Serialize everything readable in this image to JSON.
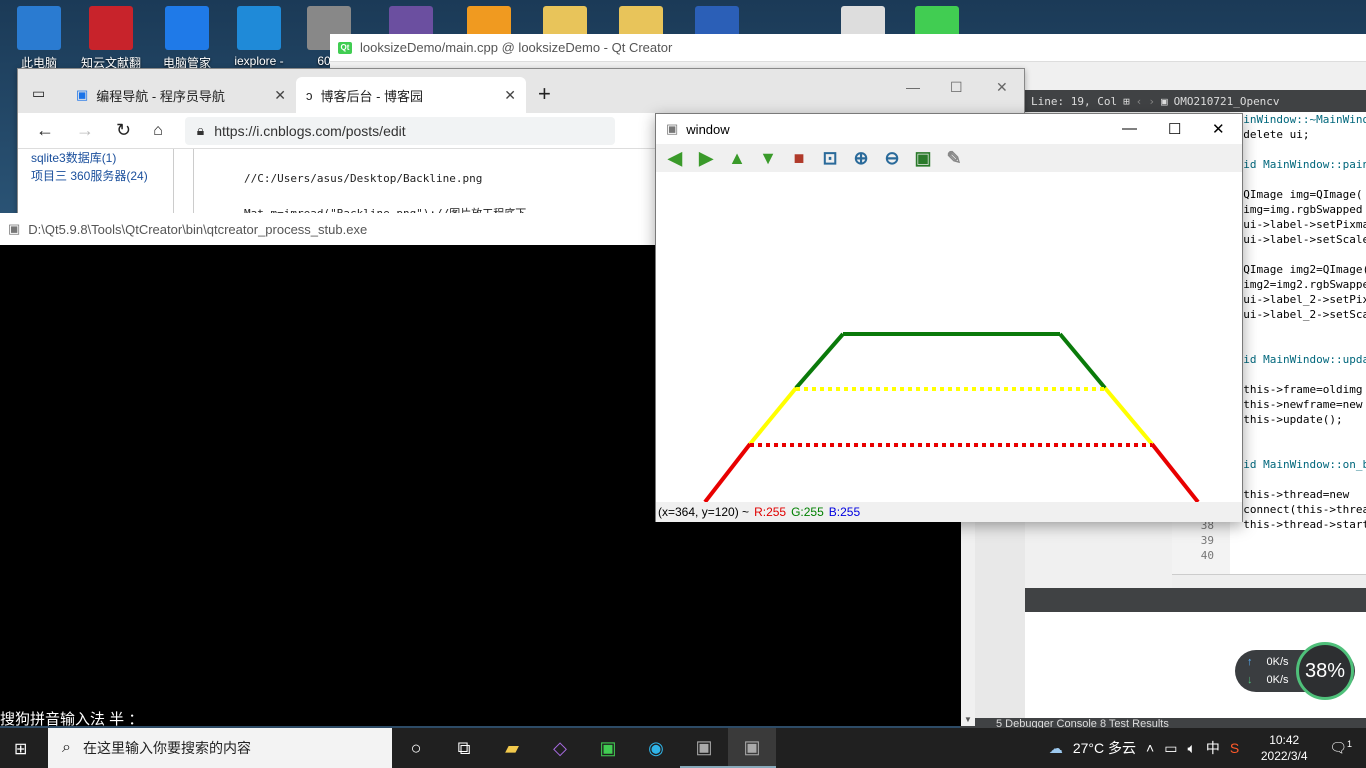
{
  "desktop": {
    "icons": [
      {
        "label": "此电脑",
        "color": "#2a7bd1"
      },
      {
        "label": "知云文献翻",
        "color": "#c8232b"
      },
      {
        "label": "电脑管家",
        "color": "#1f7ae8"
      },
      {
        "label": "iexplore -",
        "color": "#1f8ad8"
      },
      {
        "label": "60.0",
        "color": "#888"
      },
      {
        "label": "",
        "color": "#6b4fa0"
      },
      {
        "label": "",
        "color": "#f09a20"
      },
      {
        "label": "",
        "color": "#e8c45a"
      },
      {
        "label": "",
        "color": "#e8c45a"
      },
      {
        "label": "",
        "color": "#2b5fb7"
      },
      {
        "label": "",
        "color": "#ddd"
      },
      {
        "label": "",
        "color": "#41cd52"
      }
    ]
  },
  "qtcreator": {
    "title": "looksizeDemo/main.cpp @ looksizeDemo - Qt Creator",
    "logo": "Qt",
    "editorbar": {
      "line_col": "Line: 19, Col",
      "file": "OMO210721_Opencv"
    },
    "code_lines": [
      "MainWindow::~MainWindow()",
      "  delete ui;",
      "",
      "void MainWindow::paintEvent",
      "",
      "  QImage img=QImage(",
      "  img=img.rgbSwapped",
      "  ui->label->setPixmap",
      "  ui->label->setScaledContents",
      "",
      "  QImage img2=QImage(",
      "  img2=img2.rgbSwapped",
      "  ui->label_2->setPixmap",
      "  ui->label_2->setScaled",
      "",
      "",
      "void MainWindow::update",
      "",
      "  this->frame=oldimg",
      "  this->newframe=new",
      "  this->update();",
      "",
      "",
      "void MainWindow::on_btn",
      "{",
      "  this->thread=new",
      "  connect(this->thread",
      "  this->thread->start"
    ],
    "gutter": [
      "38",
      "39",
      "40"
    ],
    "bottom_tabs": "5 Debugger Console   8 Test Results"
  },
  "edge": {
    "tabs": [
      {
        "label": "编程导航 - 程序员导航"
      },
      {
        "label": "博客后台 - 博客园"
      }
    ],
    "url": "https://i.cnblogs.com/posts/edit",
    "sidebar": [
      "sqlite3数据库(1)",
      "项目三 360服务器(24)"
    ],
    "code": [
      "//C:/Users/asus/Desktop/Backline.png",
      "Mat m=imread(\"Backline.png\");//图片放工程底下"
    ]
  },
  "console": {
    "title": "D:\\Qt5.9.8\\Tools\\QtCreator\\bin\\qtcreator_process_stub.exe",
    "ime": "搜狗拼音输入法 半 ："
  },
  "cvwin": {
    "title": "window",
    "status": {
      "coords": "(x=364, y=120) ~",
      "r": "R:255",
      "g": "G:255",
      "b": "B:255"
    },
    "tools": [
      {
        "icon": "arrow-left",
        "color": "#3a9a2a",
        "glyph": "◀"
      },
      {
        "icon": "arrow-right",
        "color": "#3a9a2a",
        "glyph": "▶"
      },
      {
        "icon": "arrow-up",
        "color": "#3a9a2a",
        "glyph": "▲"
      },
      {
        "icon": "arrow-down",
        "color": "#3a9a2a",
        "glyph": "▼"
      },
      {
        "icon": "image",
        "color": "#b03a2a",
        "glyph": "■"
      },
      {
        "icon": "zoom-region",
        "color": "#2a6a9a",
        "glyph": "⊡"
      },
      {
        "icon": "zoom-in",
        "color": "#2a6a9a",
        "glyph": "⊕"
      },
      {
        "icon": "zoom-out",
        "color": "#2a6a9a",
        "glyph": "⊖"
      },
      {
        "icon": "save",
        "color": "#2a7a2a",
        "glyph": "▣"
      },
      {
        "icon": "brush",
        "color": "#888",
        "glyph": "✎"
      }
    ]
  },
  "taskbar": {
    "search_placeholder": "在这里输入你要搜索的内容",
    "weather": "27°C 多云",
    "ime_lang": "中",
    "time": "10:42",
    "date": "2022/3/4",
    "notif": "1"
  },
  "netwidget": {
    "up": "0K/s",
    "down": "0K/s",
    "percent": "38%"
  }
}
